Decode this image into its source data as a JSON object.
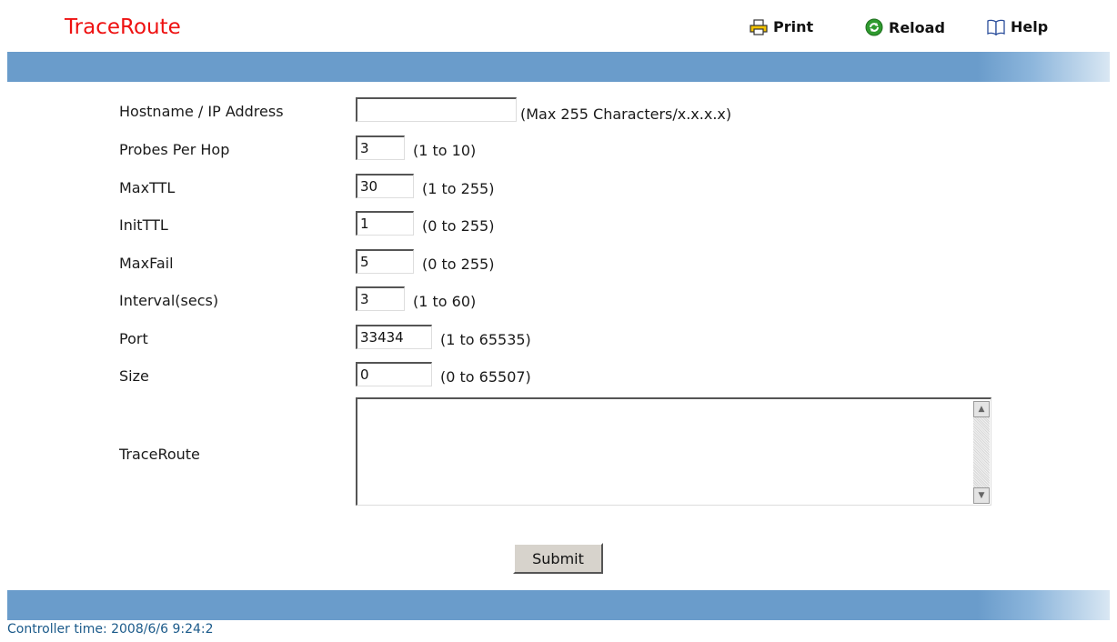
{
  "page": {
    "title": "TraceRoute"
  },
  "toolbar": {
    "print_label": "Print",
    "reload_label": "Reload",
    "help_label": "Help"
  },
  "form": {
    "hostname": {
      "label": "Hostname / IP Address",
      "value": "",
      "hint": "(Max 255 Characters/x.x.x.x)"
    },
    "probes": {
      "label": "Probes Per Hop",
      "value": "3",
      "hint": "(1 to 10)"
    },
    "maxttl": {
      "label": "MaxTTL",
      "value": "30",
      "hint": "(1 to 255)"
    },
    "initttl": {
      "label": "InitTTL",
      "value": "1",
      "hint": "(0 to 255)"
    },
    "maxfail": {
      "label": "MaxFail",
      "value": "5",
      "hint": "(0 to 255)"
    },
    "interval": {
      "label": "Interval(secs)",
      "value": "3",
      "hint": "(1 to 60)"
    },
    "port": {
      "label": "Port",
      "value": "33434",
      "hint": "(1 to 65535)"
    },
    "size": {
      "label": "Size",
      "value": "0",
      "hint": "(0 to 65507)"
    },
    "result": {
      "label": "TraceRoute",
      "value": ""
    },
    "submit_label": "Submit"
  },
  "footer": {
    "controller_time": "Controller time: 2008/6/6 9:24:2"
  },
  "colors": {
    "title": "#ee1111",
    "bar": "#6a9ccb",
    "footer_text": "#1b5a8a"
  }
}
